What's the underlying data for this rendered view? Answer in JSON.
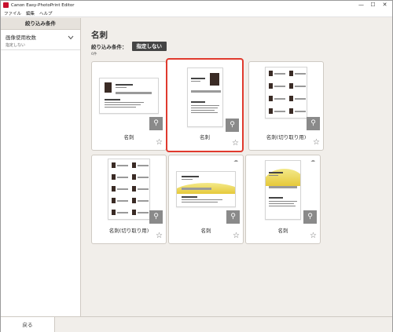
{
  "window": {
    "title": "Canon Easy-PhotoPrint Editor",
    "minimize_glyph": "—",
    "maximize_glyph": "☐",
    "close_glyph": "✕"
  },
  "menu": {
    "items": [
      "ファイル",
      "編集",
      "ヘルプ"
    ]
  },
  "sidebar": {
    "header": "絞り込み条件",
    "filters": [
      {
        "title": "画像使用枚数",
        "value": "指定しない"
      }
    ]
  },
  "main": {
    "page_title": "名刺",
    "filter_label": "絞り込み条件：",
    "filter_value": "指定しない",
    "count": "6件"
  },
  "cards": [
    {
      "label": "名刺",
      "style": "portrait-photo",
      "selected": false
    },
    {
      "label": "名刺",
      "style": "portrait-photo-large",
      "selected": true
    },
    {
      "label": "名刺(切り取り用)",
      "style": "sheet",
      "selected": false
    },
    {
      "label": "名刺(切り取り用)",
      "style": "sheet",
      "selected": false
    },
    {
      "label": "名刺",
      "style": "landscape-yellow",
      "selected": false
    },
    {
      "label": "名刺",
      "style": "portrait-yellow",
      "selected": false
    }
  ],
  "icons": {
    "zoom": "magnifier-icon",
    "favorite": "star-icon",
    "download": "cloud-download-icon",
    "chevron": "chevron-down-icon"
  },
  "footer": {
    "back_label": "戻る"
  },
  "colors": {
    "accent": "#e03a2e",
    "badge": "#444444",
    "yellow": "#e6c93a"
  }
}
